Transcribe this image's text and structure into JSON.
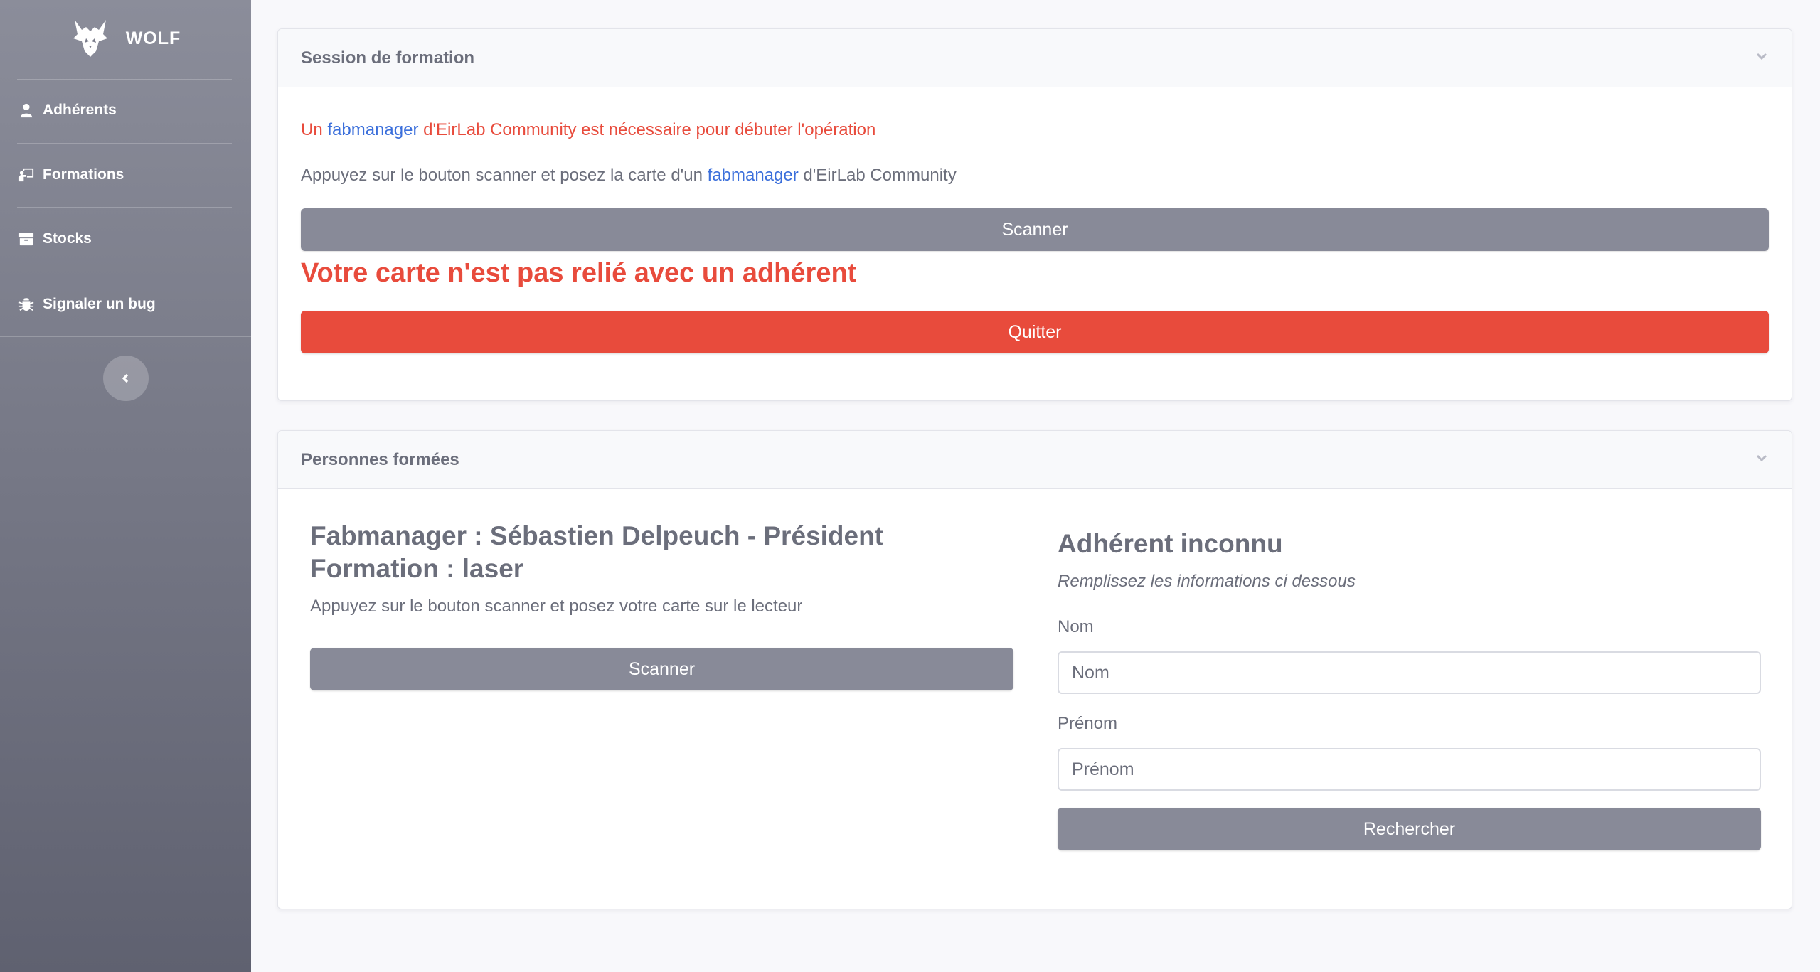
{
  "sidebar": {
    "brand": "WOLF",
    "items": [
      {
        "label": "Adhérents",
        "icon": "user-icon"
      },
      {
        "label": "Formations",
        "icon": "chalkboard-icon"
      },
      {
        "label": "Stocks",
        "icon": "box-icon"
      },
      {
        "label": "Signaler un bug",
        "icon": "bug-icon"
      }
    ],
    "collapse_icon": "chevron-left-icon"
  },
  "session": {
    "title": "Session de formation",
    "line1": {
      "part1": "Un ",
      "link": "fabmanager",
      "part2": " d'EirLab Community est nécessaire pour débuter l'opération"
    },
    "line2": {
      "part1": "Appuyez sur le bouton scanner et posez la carte d'un ",
      "link": "fabmanager",
      "part2": " d'EirLab Community"
    },
    "scan_label": "Scanner",
    "error": "Votre carte n'est pas relié avec un adhérent",
    "quit_label": "Quitter"
  },
  "trained": {
    "title": "Personnes formées",
    "fabmanager_line": "Fabmanager : Sébastien Delpeuch - Président",
    "formation_line": "Formation : laser",
    "instruction": "Appuyez sur le bouton scanner et posez votre carte sur le lecteur",
    "scan_label": "Scanner",
    "unknown": {
      "title": "Adhérent inconnu",
      "subtitle": "Remplissez les informations ci dessous",
      "nom_label": "Nom",
      "nom_placeholder": "Nom",
      "prenom_label": "Prénom",
      "prenom_placeholder": "Prénom",
      "search_label": "Rechercher"
    }
  },
  "colors": {
    "accent_red": "#e84b3c",
    "link_blue": "#3b6fdb",
    "button_grey": "#888a98"
  }
}
